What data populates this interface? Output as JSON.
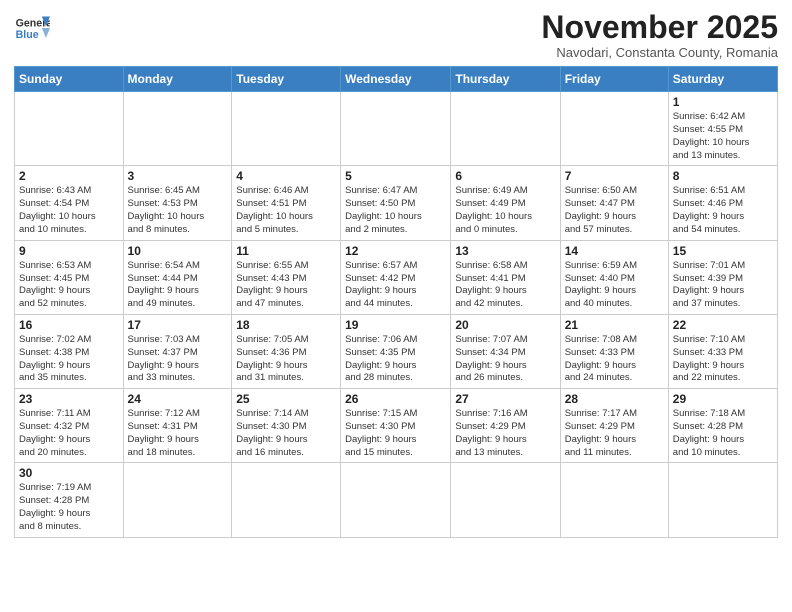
{
  "logo": {
    "line1": "General",
    "line2": "Blue"
  },
  "title": "November 2025",
  "subtitle": "Navodari, Constanta County, Romania",
  "weekdays": [
    "Sunday",
    "Monday",
    "Tuesday",
    "Wednesday",
    "Thursday",
    "Friday",
    "Saturday"
  ],
  "weeks": [
    [
      {
        "day": "",
        "info": ""
      },
      {
        "day": "",
        "info": ""
      },
      {
        "day": "",
        "info": ""
      },
      {
        "day": "",
        "info": ""
      },
      {
        "day": "",
        "info": ""
      },
      {
        "day": "",
        "info": ""
      },
      {
        "day": "1",
        "info": "Sunrise: 6:42 AM\nSunset: 4:55 PM\nDaylight: 10 hours\nand 13 minutes."
      }
    ],
    [
      {
        "day": "2",
        "info": "Sunrise: 6:43 AM\nSunset: 4:54 PM\nDaylight: 10 hours\nand 10 minutes."
      },
      {
        "day": "3",
        "info": "Sunrise: 6:45 AM\nSunset: 4:53 PM\nDaylight: 10 hours\nand 8 minutes."
      },
      {
        "day": "4",
        "info": "Sunrise: 6:46 AM\nSunset: 4:51 PM\nDaylight: 10 hours\nand 5 minutes."
      },
      {
        "day": "5",
        "info": "Sunrise: 6:47 AM\nSunset: 4:50 PM\nDaylight: 10 hours\nand 2 minutes."
      },
      {
        "day": "6",
        "info": "Sunrise: 6:49 AM\nSunset: 4:49 PM\nDaylight: 10 hours\nand 0 minutes."
      },
      {
        "day": "7",
        "info": "Sunrise: 6:50 AM\nSunset: 4:47 PM\nDaylight: 9 hours\nand 57 minutes."
      },
      {
        "day": "8",
        "info": "Sunrise: 6:51 AM\nSunset: 4:46 PM\nDaylight: 9 hours\nand 54 minutes."
      }
    ],
    [
      {
        "day": "9",
        "info": "Sunrise: 6:53 AM\nSunset: 4:45 PM\nDaylight: 9 hours\nand 52 minutes."
      },
      {
        "day": "10",
        "info": "Sunrise: 6:54 AM\nSunset: 4:44 PM\nDaylight: 9 hours\nand 49 minutes."
      },
      {
        "day": "11",
        "info": "Sunrise: 6:55 AM\nSunset: 4:43 PM\nDaylight: 9 hours\nand 47 minutes."
      },
      {
        "day": "12",
        "info": "Sunrise: 6:57 AM\nSunset: 4:42 PM\nDaylight: 9 hours\nand 44 minutes."
      },
      {
        "day": "13",
        "info": "Sunrise: 6:58 AM\nSunset: 4:41 PM\nDaylight: 9 hours\nand 42 minutes."
      },
      {
        "day": "14",
        "info": "Sunrise: 6:59 AM\nSunset: 4:40 PM\nDaylight: 9 hours\nand 40 minutes."
      },
      {
        "day": "15",
        "info": "Sunrise: 7:01 AM\nSunset: 4:39 PM\nDaylight: 9 hours\nand 37 minutes."
      }
    ],
    [
      {
        "day": "16",
        "info": "Sunrise: 7:02 AM\nSunset: 4:38 PM\nDaylight: 9 hours\nand 35 minutes."
      },
      {
        "day": "17",
        "info": "Sunrise: 7:03 AM\nSunset: 4:37 PM\nDaylight: 9 hours\nand 33 minutes."
      },
      {
        "day": "18",
        "info": "Sunrise: 7:05 AM\nSunset: 4:36 PM\nDaylight: 9 hours\nand 31 minutes."
      },
      {
        "day": "19",
        "info": "Sunrise: 7:06 AM\nSunset: 4:35 PM\nDaylight: 9 hours\nand 28 minutes."
      },
      {
        "day": "20",
        "info": "Sunrise: 7:07 AM\nSunset: 4:34 PM\nDaylight: 9 hours\nand 26 minutes."
      },
      {
        "day": "21",
        "info": "Sunrise: 7:08 AM\nSunset: 4:33 PM\nDaylight: 9 hours\nand 24 minutes."
      },
      {
        "day": "22",
        "info": "Sunrise: 7:10 AM\nSunset: 4:33 PM\nDaylight: 9 hours\nand 22 minutes."
      }
    ],
    [
      {
        "day": "23",
        "info": "Sunrise: 7:11 AM\nSunset: 4:32 PM\nDaylight: 9 hours\nand 20 minutes."
      },
      {
        "day": "24",
        "info": "Sunrise: 7:12 AM\nSunset: 4:31 PM\nDaylight: 9 hours\nand 18 minutes."
      },
      {
        "day": "25",
        "info": "Sunrise: 7:14 AM\nSunset: 4:30 PM\nDaylight: 9 hours\nand 16 minutes."
      },
      {
        "day": "26",
        "info": "Sunrise: 7:15 AM\nSunset: 4:30 PM\nDaylight: 9 hours\nand 15 minutes."
      },
      {
        "day": "27",
        "info": "Sunrise: 7:16 AM\nSunset: 4:29 PM\nDaylight: 9 hours\nand 13 minutes."
      },
      {
        "day": "28",
        "info": "Sunrise: 7:17 AM\nSunset: 4:29 PM\nDaylight: 9 hours\nand 11 minutes."
      },
      {
        "day": "29",
        "info": "Sunrise: 7:18 AM\nSunset: 4:28 PM\nDaylight: 9 hours\nand 10 minutes."
      }
    ],
    [
      {
        "day": "30",
        "info": "Sunrise: 7:19 AM\nSunset: 4:28 PM\nDaylight: 9 hours\nand 8 minutes."
      },
      {
        "day": "",
        "info": ""
      },
      {
        "day": "",
        "info": ""
      },
      {
        "day": "",
        "info": ""
      },
      {
        "day": "",
        "info": ""
      },
      {
        "day": "",
        "info": ""
      },
      {
        "day": "",
        "info": ""
      }
    ]
  ]
}
